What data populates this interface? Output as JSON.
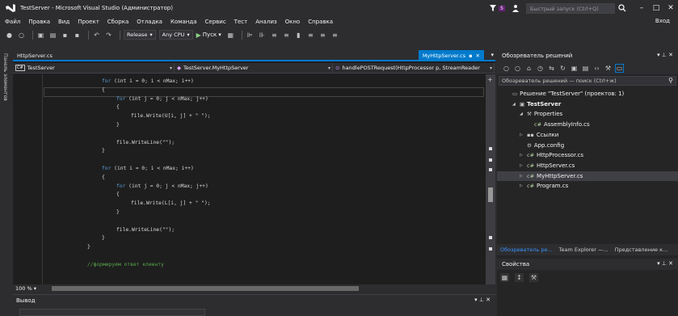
{
  "window": {
    "title": "TestServer - Microsoft Visual Studio (Администратор)",
    "notification_count": "5",
    "quick_launch_placeholder": "Быстрый запуск (Ctrl+Q)",
    "sign_in": "Вход"
  },
  "menu": [
    "Файл",
    "Правка",
    "Вид",
    "Проект",
    "Сборка",
    "Отладка",
    "Команда",
    "Сервис",
    "Тест",
    "Анализ",
    "Окно",
    "Справка"
  ],
  "toolbar": {
    "config": "Release",
    "platform": "Any CPU",
    "start_label": "Пуск"
  },
  "left_strip": {
    "label": "Панель элементов"
  },
  "editor": {
    "left_tab": "HttpServer.cs",
    "active_tab": "MyHttpServer.cs",
    "nav_project": "TestServer",
    "nav_class": "TestServer.MyHttpServer",
    "nav_member": "handlePOSTRequest(HttpProcessor p, StreamReader",
    "zoom": "100 %",
    "lines": [
      {
        "indent": 0,
        "kw": "for",
        "rest": " (int i = 0; i < nMax; i++)"
      },
      {
        "indent": 0,
        "kw": "",
        "rest": "{"
      },
      {
        "indent": 1,
        "kw": "for",
        "rest": " (int j = 0; j < nMax; j++)"
      },
      {
        "indent": 1,
        "kw": "",
        "rest": "{"
      },
      {
        "indent": 2,
        "kw": "",
        "rest": "file.Write(U[i, j] + \" \");"
      },
      {
        "indent": 1,
        "kw": "",
        "rest": "}"
      },
      {
        "indent": 0,
        "kw": "",
        "rest": ""
      },
      {
        "indent": 1,
        "kw": "",
        "rest": "file.WriteLine(\"\");"
      },
      {
        "indent": 0,
        "kw": "",
        "rest": "}"
      },
      {
        "indent": 0,
        "kw": "",
        "rest": ""
      },
      {
        "indent": 0,
        "kw": "for",
        "rest": " (int i = 0; i < nMax; i++)"
      },
      {
        "indent": 0,
        "kw": "",
        "rest": "{"
      },
      {
        "indent": 1,
        "kw": "for",
        "rest": " (int j = 0; j < nMax; j++)"
      },
      {
        "indent": 1,
        "kw": "",
        "rest": "{"
      },
      {
        "indent": 2,
        "kw": "",
        "rest": "file.Write(L[i, j] + \" \");"
      },
      {
        "indent": 1,
        "kw": "",
        "rest": "}"
      },
      {
        "indent": 0,
        "kw": "",
        "rest": ""
      },
      {
        "indent": 1,
        "kw": "",
        "rest": "file.WriteLine(\"\");"
      },
      {
        "indent": 0,
        "kw": "",
        "rest": "}"
      },
      {
        "indent": -1,
        "kw": "",
        "rest": "}"
      },
      {
        "indent": 0,
        "kw": "",
        "rest": ""
      },
      {
        "indent": -1,
        "kw": "",
        "rest": "//формируем ответ клиенту",
        "comment": true
      }
    ]
  },
  "output": {
    "title": "Вывод"
  },
  "solution_explorer": {
    "title": "Обозреватель решений",
    "search_placeholder": "Обозреватель решений — поиск (Ctrl+ж)",
    "tree": [
      {
        "level": 0,
        "arrow": "",
        "icon": "sln",
        "label": "Решение \"TestServer\" (проектов: 1)",
        "bold": false
      },
      {
        "level": 1,
        "arrow": "◢",
        "icon": "proj",
        "label": "TestServer",
        "bold": true
      },
      {
        "level": 2,
        "arrow": "◢",
        "icon": "wrench",
        "label": "Properties",
        "bold": false
      },
      {
        "level": 3,
        "arrow": "",
        "icon": "cs",
        "label": "AssemblyInfo.cs",
        "bold": false
      },
      {
        "level": 2,
        "arrow": "▷",
        "icon": "refs",
        "label": "Ссылки",
        "bold": false
      },
      {
        "level": 2,
        "arrow": "",
        "icon": "config",
        "label": "App.config",
        "bold": false
      },
      {
        "level": 2,
        "arrow": "▷",
        "icon": "cs",
        "label": "HttpProcessor.cs",
        "bold": false
      },
      {
        "level": 2,
        "arrow": "▷",
        "icon": "cs",
        "label": "HttpServer.cs",
        "bold": false
      },
      {
        "level": 2,
        "arrow": "▷",
        "icon": "cs",
        "label": "MyHttpServer.cs",
        "bold": false,
        "selected": true
      },
      {
        "level": 2,
        "arrow": "▷",
        "icon": "cs",
        "label": "Program.cs",
        "bold": false
      }
    ]
  },
  "bottom_tabs": [
    "Обозреватель ре...",
    "Team Explorer —...",
    "Представление к..."
  ],
  "properties": {
    "title": "Свойства"
  },
  "colors": {
    "accent": "#007acc",
    "keyword": "#569cd6",
    "comment": "#57a64a",
    "background": "#1e1e1e"
  }
}
